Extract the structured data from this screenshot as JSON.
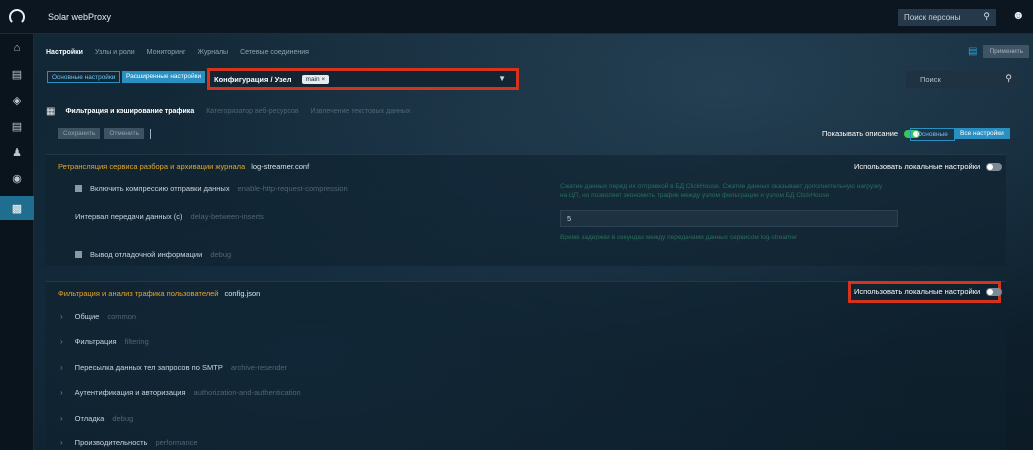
{
  "app": {
    "title": "Solar webProxy"
  },
  "topbar": {
    "search_placeholder": "Поиск персоны"
  },
  "sidebar": {
    "items": [
      {
        "icon": "home-icon"
      },
      {
        "icon": "id-card-icon"
      },
      {
        "icon": "shield-icon"
      },
      {
        "icon": "chart-icon"
      },
      {
        "icon": "users-icon"
      },
      {
        "icon": "globe-icon"
      },
      {
        "icon": "settings-doc-icon",
        "active": true
      }
    ]
  },
  "nav": {
    "tabs": [
      {
        "label": "Настройки",
        "active": true
      },
      {
        "label": "Узлы и роли"
      },
      {
        "label": "Мониторинг"
      },
      {
        "label": "Журналы"
      },
      {
        "label": "Сетевые соединения"
      }
    ],
    "apply_label": "Применить"
  },
  "modes": {
    "basic": "Основные настройки",
    "advanced": "Расширенные настройки"
  },
  "config": {
    "label": "Конфигурация / Узел",
    "chip": "main ×"
  },
  "right_search": {
    "placeholder": "Поиск"
  },
  "subtabs": [
    {
      "label": "Фильтрация и кэширование трафика",
      "active": true
    },
    {
      "label": "Категоризатор веб-ресурсов"
    },
    {
      "label": "Извлечение текстовых данных"
    }
  ],
  "toolbar": {
    "save_label": "Сохранить",
    "cancel_label": "Отменить",
    "divider": "|"
  },
  "show_desc": {
    "label": "Показывать описание",
    "on": true
  },
  "segment": {
    "basic": "Основные",
    "all": "Все настройки"
  },
  "panel1": {
    "title": "Ретрансляция сервиса разбора и архивации журнала",
    "file": "log-streamer.conf",
    "local_label": "Использовать локальные настройки",
    "rows": [
      {
        "label": "Включить компрессию отправки данных",
        "key": "enable-http-request-compression"
      },
      {
        "label": "Интервал передачи данных (с)",
        "key": "delay-between-inserts"
      },
      {
        "label": "Вывод отладочной информации",
        "key": "debug"
      }
    ],
    "compression_desc_1": "Сжатие данных перед их отправкой в БД ClickHouse. Сжатие данных оказывает дополнительную нагрузку",
    "compression_desc_2": "на ЦП, но позволяет экономить трафик между узлом фильтрации и узлом БД ClickHouse",
    "interval_value": "5",
    "interval_desc": "Время задержки в секундах между передачами данных сервисом log-streamer"
  },
  "panel2": {
    "title": "Фильтрация и анализ трафика пользователей",
    "file": "config.json",
    "local_label": "Использовать локальные настройки",
    "sections": [
      {
        "label": "Общие",
        "key": "common"
      },
      {
        "label": "Фильтрация",
        "key": "filtering"
      },
      {
        "label": "Пересылка данных тел запросов по SMTP",
        "key": "archive-resender"
      },
      {
        "label": "Аутентификация и авторизация",
        "key": "authorization-and-authentication"
      },
      {
        "label": "Отладка",
        "key": "debug"
      },
      {
        "label": "Производительность",
        "key": "performance"
      }
    ]
  },
  "colors": {
    "accent": "#2a8fc1",
    "highlight_border": "#d6331c",
    "section_title": "#e6a726",
    "toggle_on": "#35c75a"
  }
}
